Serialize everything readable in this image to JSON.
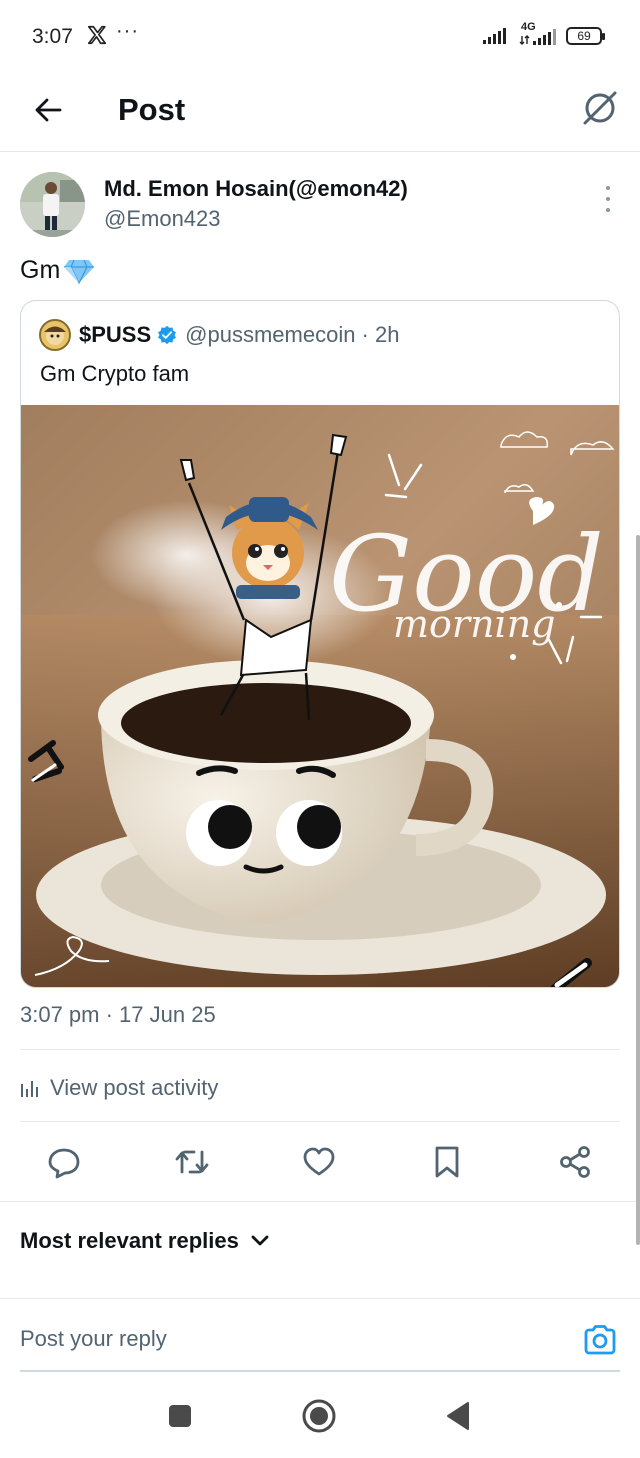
{
  "status_bar": {
    "time": "3:07",
    "dots": "···",
    "network": "4G",
    "battery": "69"
  },
  "header": {
    "title": "Post"
  },
  "post": {
    "author_name": "Md. Emon Hosain(@emon42)",
    "author_handle": "@Emon423",
    "text": "Gm",
    "timestamp": "3:07 pm · 17 Jun 25",
    "view_activity_label": "View post activity"
  },
  "quoted_post": {
    "name": "$PUSS",
    "handle": "@pussmemecoin · 2h",
    "text": "Gm Crypto fam",
    "image_text_line1": "Good",
    "image_text_line2": "morning"
  },
  "actions": {
    "icons": [
      "reply-icon",
      "repost-icon",
      "like-icon",
      "bookmark-icon",
      "share-icon"
    ]
  },
  "replies": {
    "sort_label": "Most relevant replies"
  },
  "composer": {
    "placeholder": "Post your reply"
  },
  "colors": {
    "accent": "#1d9bf0",
    "text_primary": "#0f1419",
    "text_secondary": "#536471",
    "divider": "#e6e9ec"
  }
}
